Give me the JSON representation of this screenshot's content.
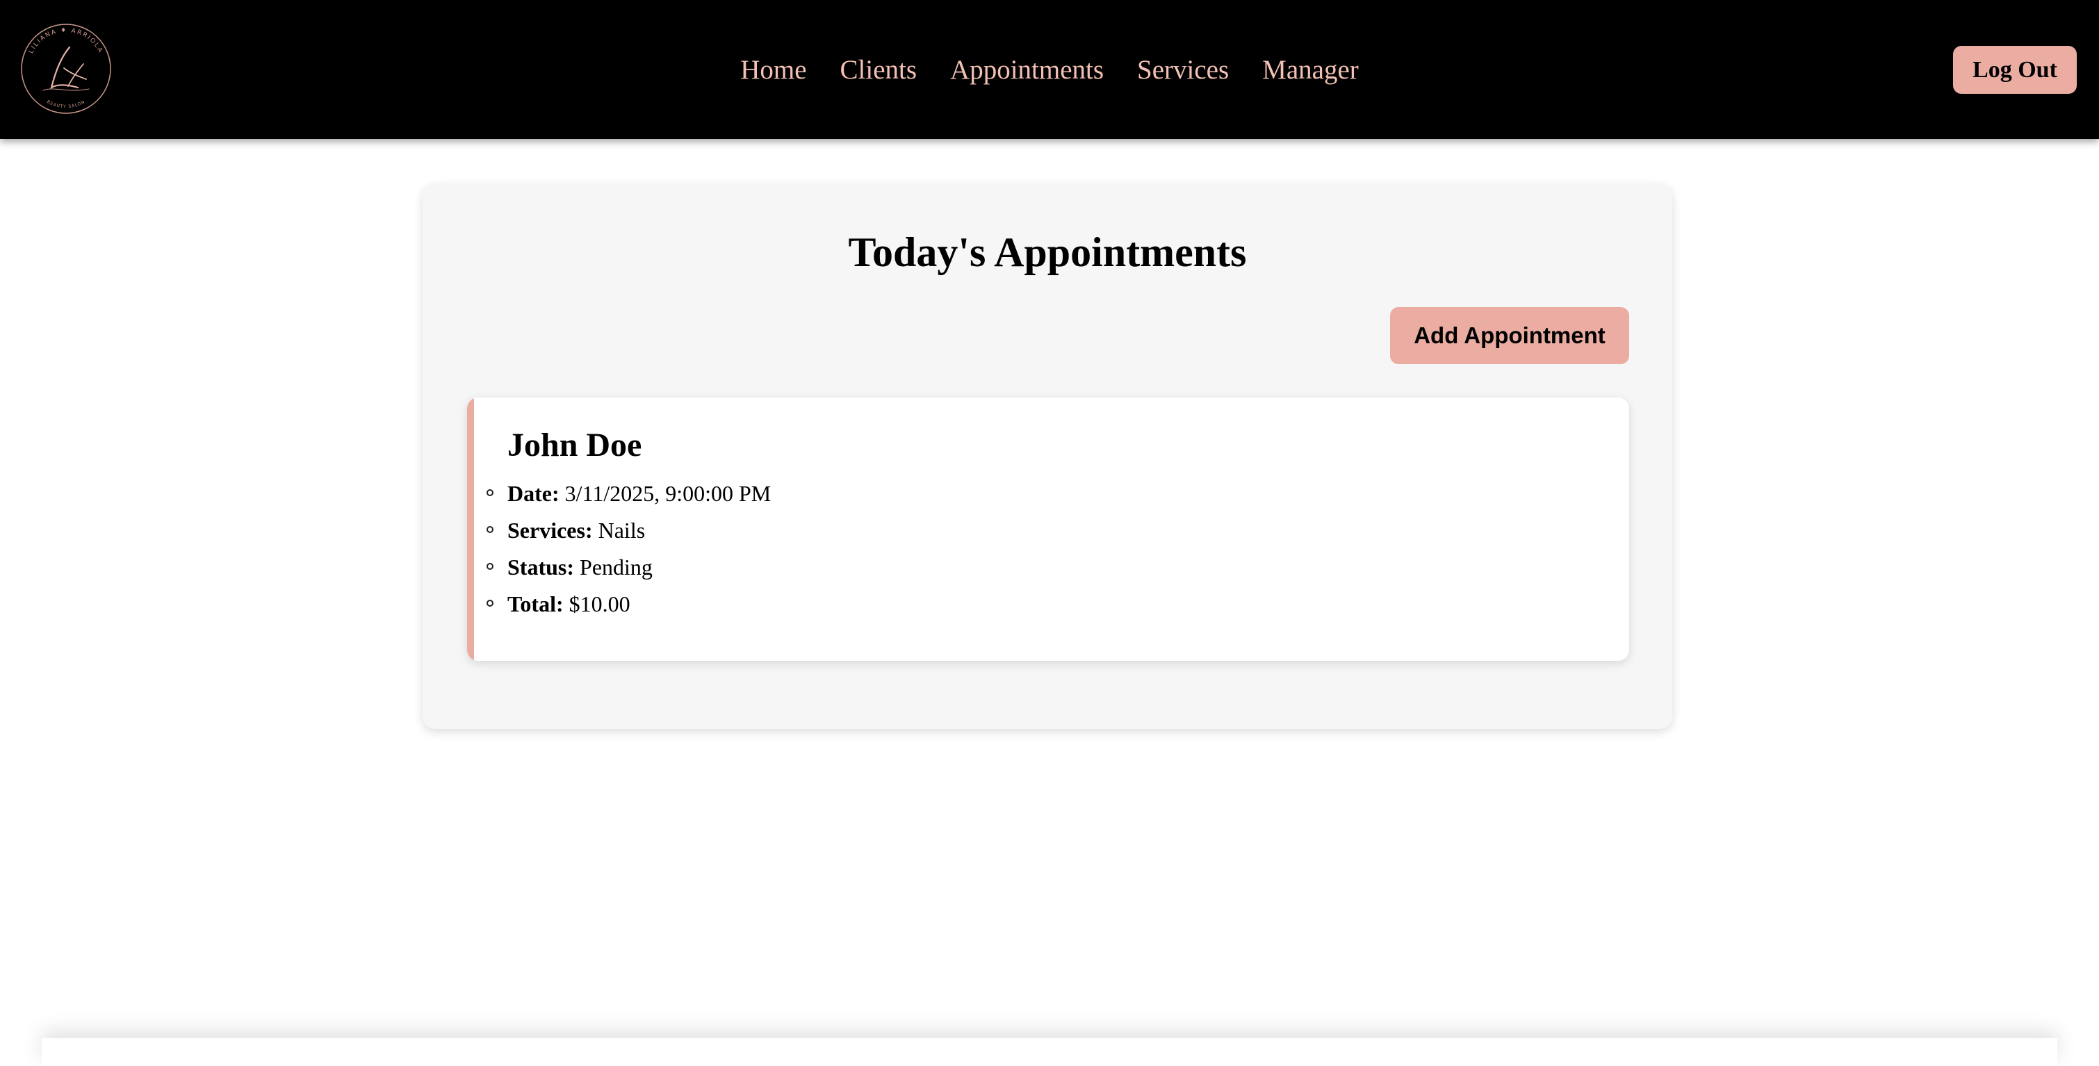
{
  "logo": {
    "brand_text": "LILIANA ARRIOLA",
    "tagline": "BEAUTY SALON",
    "monogram": "LA",
    "icon": "salon-logo-icon"
  },
  "nav": {
    "links": [
      {
        "label": "Home"
      },
      {
        "label": "Clients"
      },
      {
        "label": "Appointments"
      },
      {
        "label": "Services"
      },
      {
        "label": "Manager"
      }
    ],
    "logout_label": "Log Out"
  },
  "main": {
    "title": "Today's Appointments",
    "add_button_label": "Add Appointment",
    "appointments": [
      {
        "client_name": "John Doe",
        "date_label": "Date:",
        "date_value": "3/11/2025, 9:00:00 PM",
        "services_label": "Services:",
        "services_value": "Nails",
        "status_label": "Status:",
        "status_value": "Pending",
        "total_label": "Total:",
        "total_value": "$10.00"
      }
    ]
  },
  "colors": {
    "navbar_bg": "#000000",
    "nav_link": "#f3c1b4",
    "accent": "#ebada2",
    "panel_bg": "#f6f6f6",
    "card_bg": "#ffffff"
  }
}
